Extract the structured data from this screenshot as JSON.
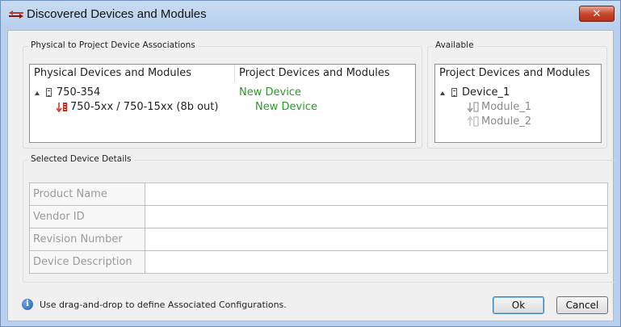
{
  "window": {
    "title": "Discovered Devices and Modules",
    "close_label": "✕"
  },
  "associations": {
    "group_title": "Physical to Project Device Associations",
    "col_physical": "Physical Devices and Modules",
    "col_project": "Project Devices and Modules",
    "rows": [
      {
        "physical": "750-354",
        "project": "New Device"
      },
      {
        "physical": "750-5xx / 750-15xx (8b out)",
        "project": "New Device"
      }
    ]
  },
  "available": {
    "group_title": "Available",
    "col_header": "Project Devices and Modules",
    "device": "Device_1",
    "modules": [
      "Module_1",
      "Module_2"
    ]
  },
  "details": {
    "group_title": "Selected Device Details",
    "fields": [
      {
        "label": "Product Name",
        "value": ""
      },
      {
        "label": "Vendor ID",
        "value": ""
      },
      {
        "label": "Revision Number",
        "value": ""
      },
      {
        "label": "Device Description",
        "value": ""
      }
    ]
  },
  "footer": {
    "info_text": "Use drag-and-drop to define Associated Configurations.",
    "ok_label": "Ok",
    "cancel_label": "Cancel"
  },
  "colors": {
    "association_text": "#2a9a2a",
    "module_available_text": "#8a8a8a"
  },
  "icons": [
    "app-arrows-icon",
    "close-icon",
    "expand-icon",
    "device-icon",
    "module-out-icon",
    "module-in-icon",
    "info-icon"
  ]
}
